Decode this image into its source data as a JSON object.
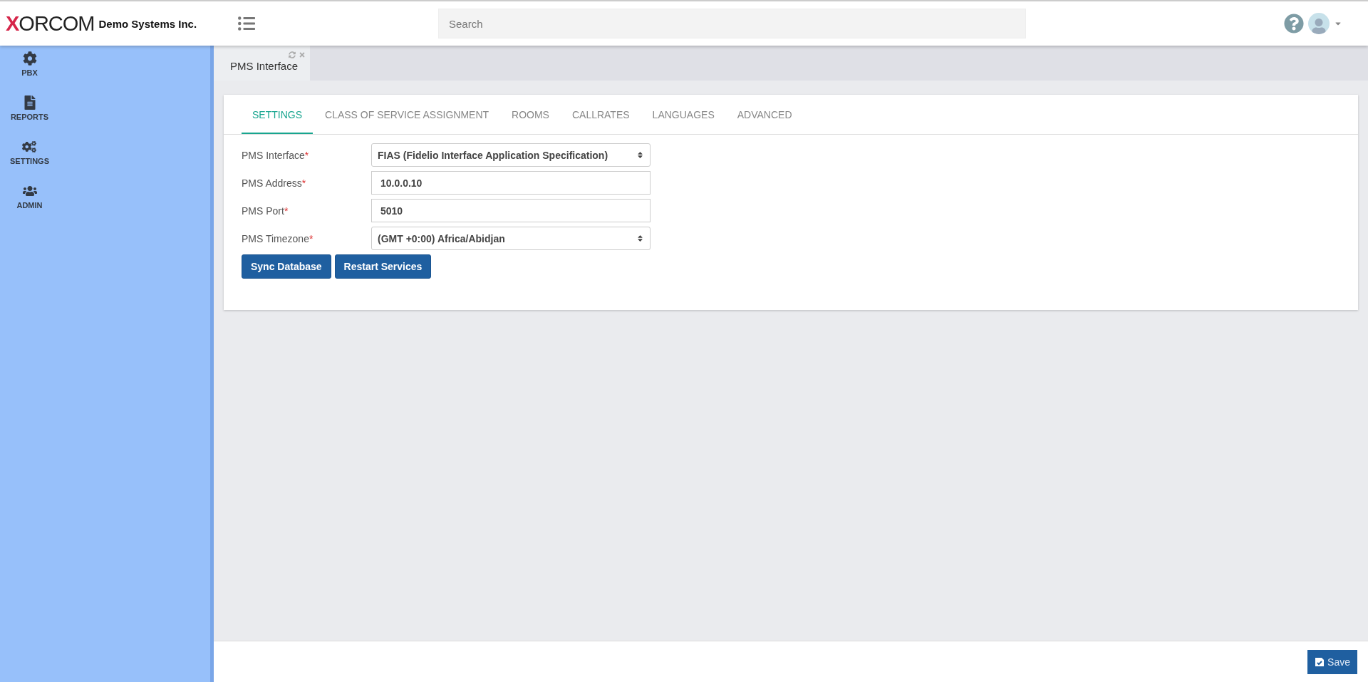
{
  "header": {
    "logo": "XORCOM",
    "company": "Demo Systems Inc.",
    "search": {
      "placeholder": "Search"
    }
  },
  "sidebar": {
    "items": [
      {
        "label": "PBX",
        "kind": "gear"
      },
      {
        "label": "REPORTS",
        "kind": "file"
      },
      {
        "label": "SETTINGS",
        "kind": "gears"
      },
      {
        "label": "ADMIN",
        "kind": "users"
      }
    ]
  },
  "page_tabs": [
    {
      "label": "PMS Interface",
      "selected": true
    }
  ],
  "tabs": [
    {
      "label": "SETTINGS",
      "selected": true
    },
    {
      "label": "CLASS OF SERVICE ASSIGNMENT",
      "selected": false
    },
    {
      "label": "ROOMS",
      "selected": false
    },
    {
      "label": "CALLRATES",
      "selected": false
    },
    {
      "label": "LANGUAGES",
      "selected": false
    },
    {
      "label": "ADVANCED",
      "selected": false
    }
  ],
  "form": {
    "fields": [
      {
        "label": "PMS Interface",
        "required_mark": "*",
        "kind": "select",
        "value": "FIAS (Fidelio Interface Application Specification)"
      },
      {
        "label": "PMS Address",
        "required_mark": "*",
        "kind": "input",
        "value": "10.0.0.10"
      },
      {
        "label": "PMS Port",
        "required_mark": "*",
        "kind": "input",
        "value": "5010"
      },
      {
        "label": "PMS Timezone",
        "required_mark": "*",
        "kind": "select",
        "value": "(GMT +0:00) Africa/Abidjan"
      }
    ],
    "buttons": [
      "Sync Database",
      "Restart Services"
    ]
  },
  "footer": {
    "save_button": "Save"
  }
}
